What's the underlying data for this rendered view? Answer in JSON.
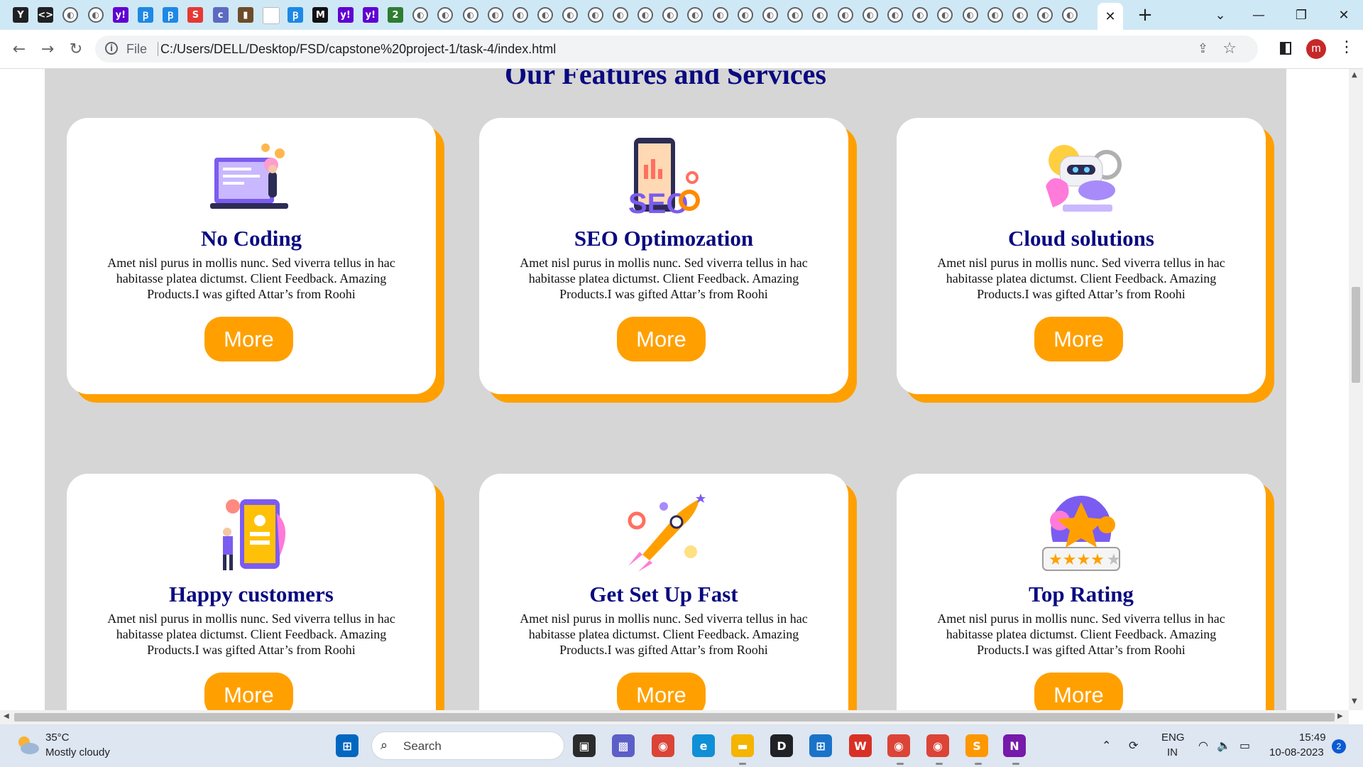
{
  "browser": {
    "tab_icons": [
      {
        "name": "yelp-favicon-icon",
        "glyph": "Y",
        "bg": "#202124"
      },
      {
        "name": "code-favicon-icon",
        "glyph": "<>",
        "bg": "#202124"
      },
      {
        "name": "globe-icon",
        "glyph": "◐",
        "bg": ""
      },
      {
        "name": "globe-icon",
        "glyph": "◐",
        "bg": ""
      },
      {
        "name": "yahoo-favicon-icon",
        "glyph": "y!",
        "bg": "#6001d2"
      },
      {
        "name": "bluefish-favicon-icon",
        "glyph": "Ꞵ",
        "bg": "#1e88e5"
      },
      {
        "name": "bluefish-favicon-icon",
        "glyph": "Ꞵ",
        "bg": "#1e88e5"
      },
      {
        "name": "s-favicon-icon",
        "glyph": "S",
        "bg": "#e53935"
      },
      {
        "name": "coloris-favicon-icon",
        "glyph": "c",
        "bg": "#5c6bc0"
      },
      {
        "name": "image-favicon-icon",
        "glyph": "▮",
        "bg": "#6d4c2a"
      },
      {
        "name": "blank-favicon-icon",
        "glyph": "",
        "bg": "#ffffff"
      },
      {
        "name": "bluefish-favicon-icon",
        "glyph": "Ꞵ",
        "bg": "#1e88e5"
      },
      {
        "name": "m-favicon-icon",
        "glyph": "M",
        "bg": "#111111"
      },
      {
        "name": "yahoo-favicon-icon",
        "glyph": "y!",
        "bg": "#6001d2"
      },
      {
        "name": "yahoo-favicon-icon",
        "glyph": "y!",
        "bg": "#6001d2"
      },
      {
        "name": "green-badge-favicon-icon",
        "glyph": "2",
        "bg": "#2e7d32"
      }
    ],
    "globe_tab_count": 27,
    "active_tab_close": "✕",
    "new_tab": "+",
    "window_controls": {
      "dropdown": "⌄",
      "minimize": "—",
      "maximize": "❐",
      "close": "✕"
    },
    "nav": {
      "back": "←",
      "forward": "→",
      "reload": "↻"
    },
    "address": {
      "scheme_label": "File",
      "url": "C:/Users/DELL/Desktop/FSD/capstone%20project-1/task-4/index.html"
    },
    "profile_initial": "m",
    "menu": "⋮"
  },
  "page": {
    "section_title": "Our Features and Services",
    "cards": [
      {
        "title": "No Coding",
        "text": "Amet nisl purus in mollis nunc. Sed viverra tellus in hac habitasse platea dictumst. Client Feedback. Amazing Products.I was gifted Attar’s from Roohi",
        "button": "More",
        "illustration": "coding-illustration"
      },
      {
        "title": "SEO Optimozation",
        "text": "Amet nisl purus in mollis nunc. Sed viverra tellus in hac habitasse platea dictumst. Client Feedback. Amazing Products.I was gifted Attar’s from Roohi",
        "button": "More",
        "illustration": "seo-illustration"
      },
      {
        "title": "Cloud solutions",
        "text": "Amet nisl purus in mollis nunc. Sed viverra tellus in hac habitasse platea dictumst. Client Feedback. Amazing Products.I was gifted Attar’s from Roohi",
        "button": "More",
        "illustration": "cloud-robot-illustration"
      },
      {
        "title": "Happy customers",
        "text": "Amet nisl purus in mollis nunc. Sed viverra tellus in hac habitasse platea dictumst. Client Feedback. Amazing Products.I was gifted Attar’s from Roohi",
        "button": "More",
        "illustration": "happy-customer-illustration"
      },
      {
        "title": "Get Set Up Fast",
        "text": "Amet nisl purus in mollis nunc. Sed viverra tellus in hac habitasse platea dictumst. Client Feedback. Amazing Products.I was gifted Attar’s from Roohi",
        "button": "More",
        "illustration": "rocket-illustration"
      },
      {
        "title": "Top Rating",
        "text": "Amet nisl purus in mollis nunc. Sed viverra tellus in hac habitasse platea dictumst. Client Feedback. Amazing Products.I was gifted Attar’s from Roohi",
        "button": "More",
        "illustration": "star-rating-illustration"
      }
    ]
  },
  "taskbar": {
    "weather": {
      "temp": "35°C",
      "desc": "Mostly cloudy"
    },
    "search_label": "Search",
    "apps": [
      {
        "name": "start-button",
        "glyph": "⊞",
        "bg": "#0067c0"
      },
      {
        "name": "task-view-icon",
        "glyph": "▣",
        "bg": "#2b2b2b"
      },
      {
        "name": "teams-chat-icon",
        "glyph": "▩",
        "bg": "#5b5fc7"
      },
      {
        "name": "chrome-icon",
        "glyph": "◉",
        "bg": "#db4437"
      },
      {
        "name": "edge-icon",
        "glyph": "e",
        "bg": "#0f8fd6"
      },
      {
        "name": "file-explorer-icon",
        "glyph": "▬",
        "bg": "#f4b400"
      },
      {
        "name": "dell-icon",
        "glyph": "D",
        "bg": "#202124"
      },
      {
        "name": "microsoft-store-icon",
        "glyph": "⊞",
        "bg": "#1a73c8"
      },
      {
        "name": "wps-office-icon",
        "glyph": "W",
        "bg": "#d93025"
      },
      {
        "name": "chrome-profile-m-icon",
        "glyph": "◉",
        "bg": "#db4437"
      },
      {
        "name": "chrome-icon",
        "glyph": "◉",
        "bg": "#db4437"
      },
      {
        "name": "sublime-text-icon",
        "glyph": "S",
        "bg": "#ff9800"
      },
      {
        "name": "onenote-icon",
        "glyph": "N",
        "bg": "#7719aa"
      }
    ],
    "tray": {
      "chevron": "⌃",
      "sync": "⟳",
      "wifi": "◠",
      "volume": "🔈",
      "battery": "▭"
    },
    "lang_line1": "ENG",
    "lang_line2": "IN",
    "time": "15:49",
    "date": "10-08-2023",
    "notification_count": "2"
  },
  "scrollbar": {
    "up": "▲",
    "down": "▼",
    "left": "◀",
    "right": "▶"
  }
}
